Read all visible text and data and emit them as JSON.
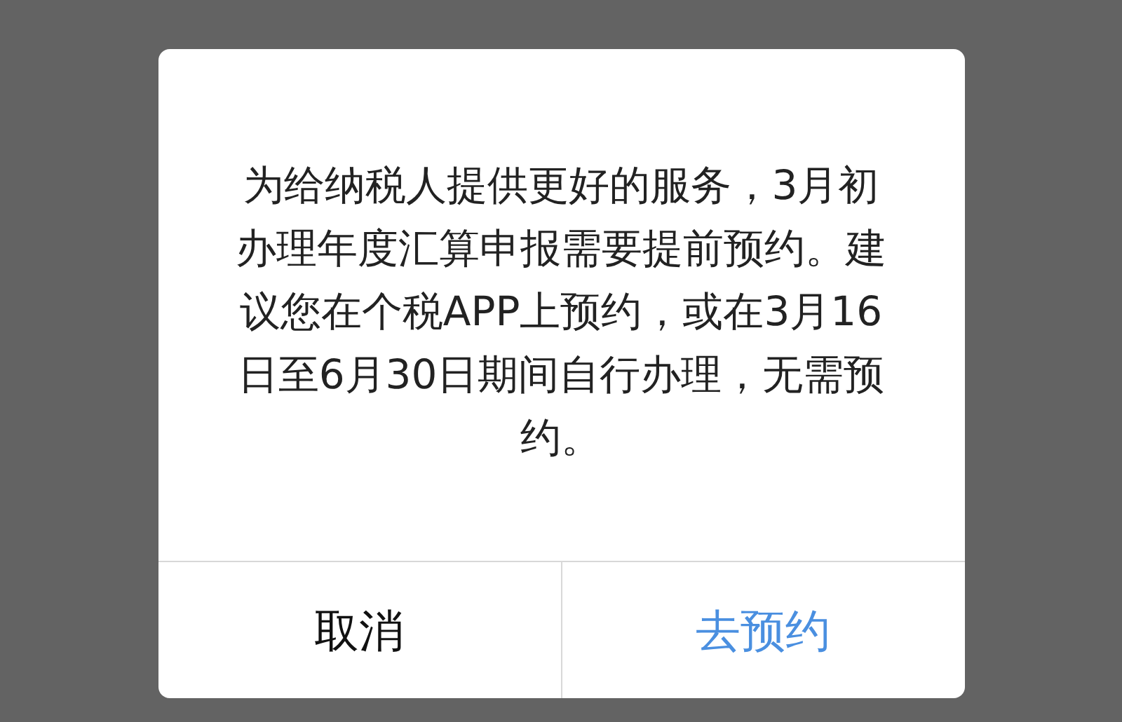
{
  "dialog": {
    "message": "为给纳税人提供更好的服务，3月初办理年度汇算申报需要提前预约。建议您在个税APP上预约，或在3月16日至6月30日期间自行办理，无需预约。",
    "buttons": [
      {
        "label": "取消",
        "kind": "cancel"
      },
      {
        "label": "去预约",
        "kind": "primary"
      }
    ]
  }
}
